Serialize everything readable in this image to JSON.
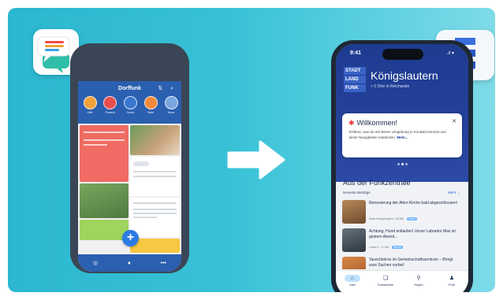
{
  "colors": {
    "background_start": "#2bb7cf",
    "background_end": "#7fdbe8",
    "dorffunk_blue": "#2b5fb0",
    "stadtland_blue": "#1d3b8f"
  },
  "dorffunk": {
    "icon": "chat-bubbles-icon",
    "app_title": "Dorffunk",
    "categories": [
      {
        "label": "Hilfe",
        "color": "#f0a23a"
      },
      {
        "label": "Plausch",
        "color": "#e8504f"
      },
      {
        "label": "Suche",
        "color": "#ffffff"
      },
      {
        "label": "Biete",
        "color": "#f08a3a"
      },
      {
        "label": "News",
        "color": "#7aa6e0"
      }
    ],
    "fab_label": "+",
    "tabbar": [
      "compass-icon",
      "pin-icon",
      "more-icon"
    ]
  },
  "stadtland": {
    "icon": "stadtland-logo-icon",
    "status_time": "9:41",
    "status_signal": ".ıl ▾",
    "logo_lines": [
      "STADT",
      "LAND",
      "FUNK"
    ],
    "city_name": "Königslautern",
    "city_subtitle": "+ 5 Orte in Reichweite",
    "welcome_title": "Willkommen!",
    "welcome_text": "Erfahre, was du mit deiner Umgebung in Kontakt kommst und lieser Neuigkeiten entdecken.",
    "welcome_more": "Mehr...",
    "close_label": "✕",
    "section_title": "Aus der Funkzentrale",
    "section_subtitle": "Neueste Beiträge",
    "section_more": "Mehr →",
    "news": [
      {
        "title": "Renovierung der Alten Kirche bald abgeschlossen!",
        "meta": "Stadt Königslautern • 45 Min.",
        "tag": "News",
        "thumb": "#8a6a4a"
      },
      {
        "title": "Achtung, Hund entlaufen! Unser Labrador Max ist gestern Abend...",
        "meta": "Lukas K. • 1 Std.",
        "tag": "Suche",
        "thumb": "#4b5a66"
      },
      {
        "title": "Tauschbörse im Gemeinschaftszentrum – Bringt eure Sachen vorbei!",
        "meta": "",
        "tag": "",
        "thumb": "#c77b3b"
      }
    ],
    "tabs": [
      {
        "label": "Start",
        "icon": "home-icon",
        "active": true
      },
      {
        "label": "Funkzentrale",
        "icon": "chat-icon",
        "active": false
      },
      {
        "label": "Region",
        "icon": "map-pin-icon",
        "active": false
      },
      {
        "label": "Profil",
        "icon": "user-icon",
        "active": false
      }
    ]
  }
}
